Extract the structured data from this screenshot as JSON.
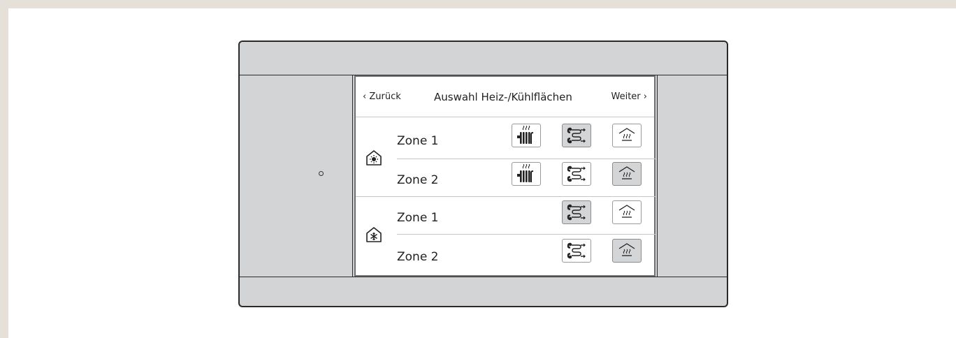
{
  "header": {
    "back_label": "Zurück",
    "title": "Auswahl Heiz-/Kühlflächen",
    "next_label": "Weiter"
  },
  "groups": [
    {
      "mode_icon": "house-sun-icon",
      "zones": [
        {
          "label": "Zone 1",
          "options": [
            "radiator",
            "floor-circuit",
            "surface-heating"
          ],
          "selected": "floor-circuit"
        },
        {
          "label": "Zone 2",
          "options": [
            "radiator",
            "floor-circuit",
            "surface-heating"
          ],
          "selected": "surface-heating"
        }
      ]
    },
    {
      "mode_icon": "house-snowflake-icon",
      "zones": [
        {
          "label": "Zone 1",
          "options": [
            "floor-circuit",
            "surface-heating"
          ],
          "selected": "floor-circuit"
        },
        {
          "label": "Zone 2",
          "options": [
            "floor-circuit",
            "surface-heating"
          ],
          "selected": "surface-heating"
        }
      ]
    }
  ],
  "colors": {
    "frame": "#e5e1d8",
    "device_body": "#d3d4d6",
    "selected_button": "#d4d5d7",
    "outline": "#2a2a2a"
  }
}
